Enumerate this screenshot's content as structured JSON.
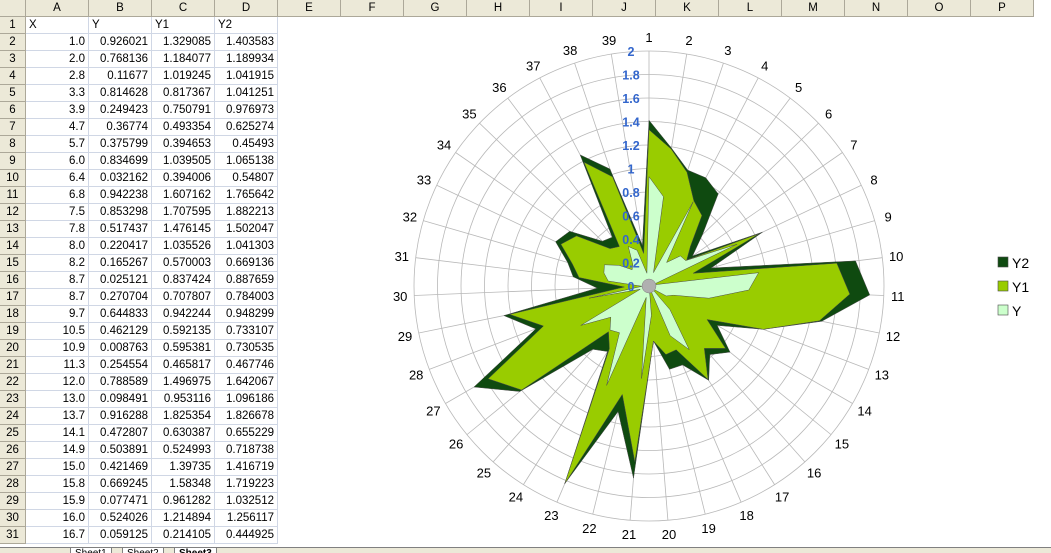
{
  "columns": [
    "A",
    "B",
    "C",
    "D",
    "E",
    "F",
    "G",
    "H",
    "I",
    "J",
    "K",
    "L",
    "M",
    "N",
    "O",
    "P"
  ],
  "header_row": [
    "X",
    "Y",
    "Y1",
    "Y2"
  ],
  "rows": [
    [
      "1.0",
      "0.926021",
      "1.329085",
      "1.403583"
    ],
    [
      "2.0",
      "0.768136",
      "1.184077",
      "1.189934"
    ],
    [
      "2.8",
      "0.11677",
      "1.019245",
      "1.041915"
    ],
    [
      "3.3",
      "0.814628",
      "0.817367",
      "1.041251"
    ],
    [
      "3.9",
      "0.249423",
      "0.750791",
      "0.976973"
    ],
    [
      "4.7",
      "0.36774",
      "0.493354",
      "0.625274"
    ],
    [
      "5.7",
      "0.375799",
      "0.394653",
      "0.45493"
    ],
    [
      "6.0",
      "0.834699",
      "1.039505",
      "1.065138"
    ],
    [
      "6.4",
      "0.032162",
      "0.394006",
      "0.54807"
    ],
    [
      "6.8",
      "0.942238",
      "1.607162",
      "1.765642"
    ],
    [
      "7.5",
      "0.853298",
      "1.707595",
      "1.882213"
    ],
    [
      "7.8",
      "0.517437",
      "1.476145",
      "1.502047"
    ],
    [
      "8.0",
      "0.220417",
      "1.035526",
      "1.041303"
    ],
    [
      "8.2",
      "0.165267",
      "0.570003",
      "0.669136"
    ],
    [
      "8.7",
      "0.025121",
      "0.837424",
      "0.887659"
    ],
    [
      "8.7",
      "0.270704",
      "0.707807",
      "0.784003"
    ],
    [
      "9.7",
      "0.644833",
      "0.942244",
      "0.948299"
    ],
    [
      "10.5",
      "0.462129",
      "0.592135",
      "0.733107"
    ],
    [
      "10.9",
      "0.008763",
      "0.595381",
      "0.730535"
    ],
    [
      "11.3",
      "0.254554",
      "0.465817",
      "0.467746"
    ],
    [
      "12.0",
      "0.788589",
      "1.496975",
      "1.642067"
    ],
    [
      "13.0",
      "0.098491",
      "0.953116",
      "1.096186"
    ],
    [
      "13.7",
      "0.916288",
      "1.825354",
      "1.826678"
    ],
    [
      "14.1",
      "0.472807",
      "0.630387",
      "0.655229"
    ],
    [
      "14.9",
      "0.503891",
      "0.524993",
      "0.718738"
    ],
    [
      "15.0",
      "0.421469",
      "1.39735",
      "1.416719"
    ],
    [
      "15.8",
      "0.669245",
      "1.58348",
      "1.719223"
    ],
    [
      "15.9",
      "0.077471",
      "0.961282",
      "1.032512"
    ],
    [
      "16.0",
      "0.524026",
      "1.214894",
      "1.256117"
    ],
    [
      "16.7",
      "0.059125",
      "0.214105",
      "0.444925"
    ]
  ],
  "sheet_tabs": [
    "Sheet1",
    "Sheet2",
    "Sheet3"
  ],
  "chart_data": {
    "type": "radar-filled",
    "categories": [
      "1",
      "2",
      "3",
      "4",
      "5",
      "6",
      "7",
      "8",
      "9",
      "10",
      "11",
      "12",
      "13",
      "14",
      "15",
      "16",
      "17",
      "18",
      "19",
      "20",
      "21",
      "22",
      "23",
      "24",
      "25",
      "26",
      "27",
      "28",
      "29",
      "30",
      "31",
      "32",
      "33",
      "34",
      "35",
      "36",
      "37",
      "38",
      "39"
    ],
    "radial_ticks": [
      "0",
      "0.2",
      "0.4",
      "0.6",
      "0.8",
      "1",
      "1.2",
      "1.4",
      "1.6",
      "1.8",
      "2"
    ],
    "rmax": 2,
    "legend_position": "right",
    "series": [
      {
        "name": "Y2",
        "color": "#0f4a10",
        "values": [
          1.41,
          1.19,
          1.04,
          1.04,
          0.98,
          0.63,
          0.45,
          1.07,
          0.55,
          1.77,
          1.88,
          1.5,
          1.04,
          0.67,
          0.89,
          0.78,
          0.95,
          0.73,
          0.73,
          0.47,
          1.64,
          1.1,
          1.83,
          0.66,
          0.72,
          1.42,
          1.72,
          1.03,
          1.26,
          0.44,
          0.65,
          0.72,
          0.88,
          0.82,
          0.55,
          0.52,
          1.26,
          1.05,
          0.35
        ]
      },
      {
        "name": "Y1",
        "color": "#99cc00",
        "values": [
          1.33,
          1.18,
          1.02,
          0.82,
          0.75,
          0.49,
          0.39,
          1.04,
          0.39,
          1.61,
          1.71,
          1.48,
          1.04,
          0.57,
          0.84,
          0.71,
          0.94,
          0.59,
          0.6,
          0.47,
          1.5,
          0.95,
          1.83,
          0.63,
          0.52,
          1.4,
          1.58,
          0.96,
          1.21,
          0.21,
          0.6,
          0.68,
          0.83,
          0.75,
          0.46,
          0.42,
          1.19,
          0.98,
          0.28
        ]
      },
      {
        "name": "Y",
        "color": "#ccffcc",
        "values": [
          0.93,
          0.77,
          0.12,
          0.81,
          0.25,
          0.37,
          0.38,
          0.83,
          0.03,
          0.94,
          0.85,
          0.52,
          0.22,
          0.17,
          0.03,
          0.27,
          0.64,
          0.46,
          0.01,
          0.25,
          0.79,
          0.1,
          0.92,
          0.47,
          0.5,
          0.42,
          0.67,
          0.08,
          0.52,
          0.06,
          0.35,
          0.4,
          0.42,
          0.31,
          0.2,
          0.23,
          0.38,
          0.32,
          0.11
        ]
      }
    ]
  }
}
